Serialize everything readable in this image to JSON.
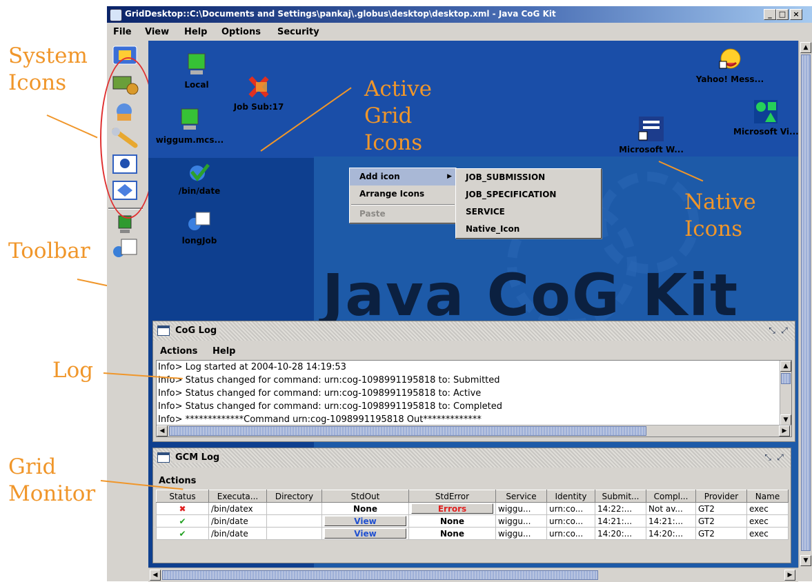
{
  "window": {
    "title": "GridDesktop::C:\\Documents and Settings\\pankaj\\.globus\\desktop\\desktop.xml - Java CoG Kit",
    "controls": [
      "_",
      "□",
      "×"
    ]
  },
  "menubar": {
    "items": [
      "File",
      "View",
      "Help",
      "Options",
      "Security"
    ]
  },
  "annotations": {
    "system_icons": "System\nIcons",
    "active_grid_icons": "Active\nGrid\nIcons",
    "native_icons": "Native\nIcons",
    "toolbar": "Toolbar",
    "log": "Log",
    "grid_monitor": "Grid\nMonitor",
    "color": "#f0962a"
  },
  "desktop": {
    "watermark": "Java CoG Kit",
    "icons": [
      {
        "label": "Local",
        "icon": "monitor-icon"
      },
      {
        "label": "Job Sub:17",
        "icon": "failed-job-icon"
      },
      {
        "label": "wiggum.mcs...",
        "icon": "monitor-icon"
      },
      {
        "label": "/bin/date",
        "icon": "check-job-icon"
      },
      {
        "label": "longJob",
        "icon": "job-spec-icon"
      },
      {
        "label": "Yahoo! Mess...",
        "icon": "yahoo-messenger-icon"
      },
      {
        "label": "Microsoft Vi...",
        "icon": "visio-icon"
      },
      {
        "label": "Microsoft W...",
        "icon": "word-icon"
      }
    ]
  },
  "context_menu": {
    "items": [
      "Add icon",
      "Arrange Icons",
      "Paste"
    ],
    "submenu": [
      "JOB_SUBMISSION",
      "JOB_SPECIFICATION",
      "SERVICE",
      "Native_Icon"
    ]
  },
  "cog_log": {
    "title": "CoG Log",
    "menu": [
      "Actions",
      "Help"
    ],
    "lines": [
      "Info> Log started at 2004-10-28 14:19:53",
      "Info> Status changed for command: urn:cog-1098991195818 to: Submitted",
      "Info> Status changed for command: urn:cog-1098991195818 to: Active",
      "Info> Status changed for command: urn:cog-1098991195818 to: Completed",
      "Info> *************Command urn:cog-1098991195818 Out*************"
    ]
  },
  "gcm_log": {
    "title": "GCM Log",
    "menu": [
      "Actions"
    ],
    "columns": [
      "Status",
      "Executa...",
      "Directory",
      "StdOut",
      "StdError",
      "Service",
      "Identity",
      "Submit...",
      "Compl...",
      "Provider",
      "Name"
    ],
    "rows": [
      {
        "status": "✖",
        "status_color": "#e02020",
        "exec": "/bin/datex",
        "dir": "",
        "stdout": "None",
        "stdout_btn": false,
        "stderr": "Errors",
        "stderr_btn": true,
        "service": "wiggu...",
        "identity": "urn:co...",
        "submit": "14:22:...",
        "compl": "Not av...",
        "provider": "GT2",
        "name": "exec"
      },
      {
        "status": "✔",
        "status_color": "#20a020",
        "exec": "/bin/date",
        "dir": "",
        "stdout": "View",
        "stdout_btn": true,
        "stderr": "None",
        "stderr_btn": false,
        "service": "wiggu...",
        "identity": "urn:co...",
        "submit": "14:21:...",
        "compl": "14:21:...",
        "provider": "GT2",
        "name": "exec"
      },
      {
        "status": "✔",
        "status_color": "#20a020",
        "exec": "/bin/date",
        "dir": "",
        "stdout": "View",
        "stdout_btn": true,
        "stderr": "None",
        "stderr_btn": false,
        "service": "wiggu...",
        "identity": "urn:co...",
        "submit": "14:20:...",
        "compl": "14:20:...",
        "provider": "GT2",
        "name": "exec"
      }
    ]
  }
}
